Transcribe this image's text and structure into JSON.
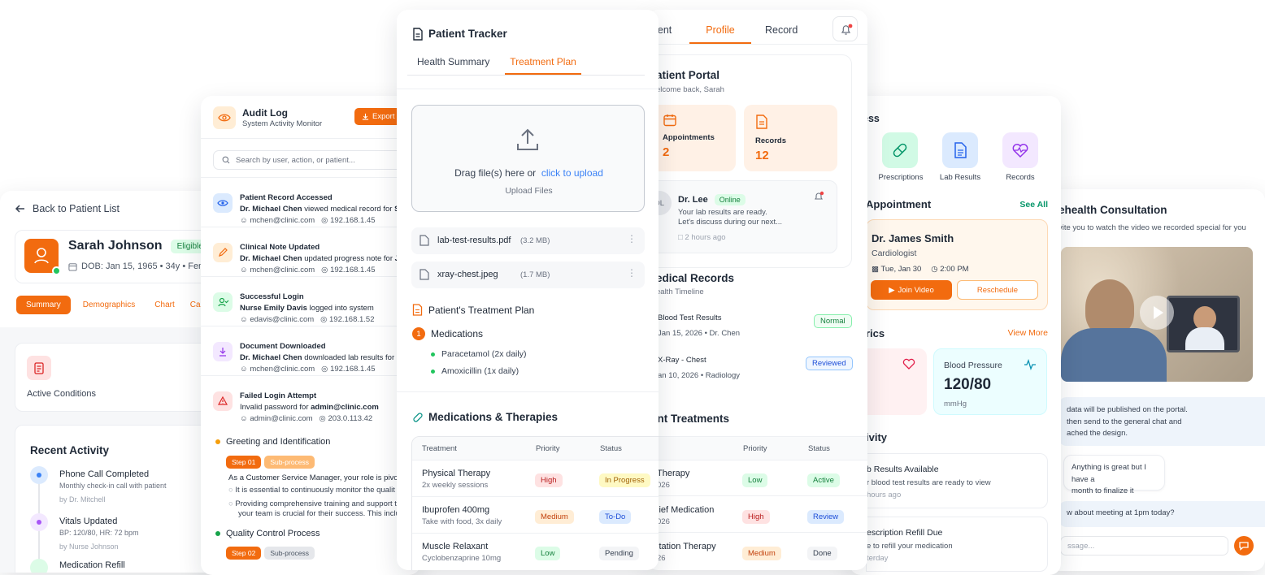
{
  "colors": {
    "accent": "#f26b0f",
    "green": "#16a34a",
    "blue": "#2563eb"
  },
  "patientList": {
    "back": "Back to Patient List",
    "name": "Sarah Johnson",
    "eligible": "Eligible",
    "dob": "DOB: Jan 15, 1965 • 34y • Fema",
    "tabs": [
      "Summary",
      "Demographics",
      "Chart",
      "Ca"
    ],
    "activeConditions": "Active Conditions",
    "recentActivity": "Recent Activity",
    "activities": [
      {
        "title": "Phone Call Completed",
        "desc": "Monthly check-in call with patient",
        "by": "by Dr. Mitchell"
      },
      {
        "title": "Vitals Updated",
        "desc": "BP: 120/80, HR: 72 bpm",
        "by": "by Nurse Johnson"
      },
      {
        "title": "Medication Refill",
        "desc": "",
        "by": ""
      }
    ]
  },
  "audit": {
    "title": "Audit Log",
    "subtitle": "System Activity Monitor",
    "export": "Export",
    "search_placeholder": "Search by user, action, or patient...",
    "entries": [
      {
        "title": "Patient Record Accessed",
        "actor": "Dr. Michael Chen",
        "action": " viewed medical record for ",
        "target": "Sa",
        "email": "mchen@clinic.com",
        "ip": "192.168.1.45"
      },
      {
        "title": "Clinical Note Updated",
        "actor": "Dr. Michael Chen",
        "action": " updated progress note for ",
        "target": "Ja",
        "email": "mchen@clinic.com",
        "ip": "192.168.1.45"
      },
      {
        "title": "Successful Login",
        "actor": "Nurse Emily Davis",
        "action": " logged into system",
        "target": "",
        "email": "edavis@clinic.com",
        "ip": "192.168.1.52"
      },
      {
        "title": "Document Downloaded",
        "actor": "Dr. Michael Chen",
        "action": " downloaded lab results for ",
        "target": "S",
        "email": "mchen@clinic.com",
        "ip": "192.168.1.45"
      },
      {
        "title": "Failed Login Attempt",
        "actor": "",
        "action": "Invalid password for ",
        "target": "admin@clinic.com",
        "email": "admin@clinic.com",
        "ip": "203.0.113.42"
      }
    ],
    "workflow": [
      {
        "title": "Greeting and Identification",
        "step": "Step 01",
        "sub": "Sub-process",
        "text": "As a Customer Service Manager, your role is pivot",
        "bullets": [
          "It is essential to continuously monitor the qualit",
          "Providing comprehensive training and support t",
          "your team is crucial for their success. This inclu"
        ]
      },
      {
        "title": "Quality Control Process",
        "step": "Step 02",
        "sub": "Sub-process"
      }
    ]
  },
  "tracker": {
    "title": "Patient Tracker",
    "tabs": [
      "Health Summary",
      "Treatment Plan"
    ],
    "upload_text": "Drag file(s) here or",
    "upload_link": "click to upload",
    "upload_sub": "Upload Files",
    "files": [
      {
        "name": "lab-test-results.pdf",
        "size": "(3.2 MB)"
      },
      {
        "name": "xray-chest.jpeg",
        "size": "(1.7 MB)"
      }
    ],
    "plan_title": "Patient's Treatment Plan",
    "plan_num": "1",
    "plan_section": "Medications",
    "meds": [
      "Paracetamol (2x daily)",
      "Amoxicillin (1x daily)"
    ],
    "mt_title": "Medications & Therapies",
    "headers": [
      "Treatment",
      "Priority",
      "Status"
    ],
    "rows": [
      {
        "name": "Physical Therapy",
        "sub": "2x weekly sessions",
        "priority": "High",
        "status": "In Progress"
      },
      {
        "name": "Ibuprofen 400mg",
        "sub": "Take with food, 3x daily",
        "priority": "Medium",
        "status": "To-Do"
      },
      {
        "name": "Muscle Relaxant",
        "sub": "Cyclobenzaprine 10mg",
        "priority": "Low",
        "status": "Pending"
      }
    ]
  },
  "portal": {
    "tabs": [
      "tment",
      "Profile",
      "Record"
    ],
    "title": "atient Portal",
    "welcome": "elcome back, Sarah",
    "stat1_label": "Appointments",
    "stat1_value": "2",
    "stat2_label": "Records",
    "stat2_value": "12",
    "msg_name": "Dr. Lee",
    "msg_status": "Online",
    "msg_avatar": "DL",
    "msg_text1": "Your lab results are ready.",
    "msg_text2": "Let's discuss during our next...",
    "msg_time": "2 hours ago",
    "rec_title": "edical Records",
    "rec_sub": "ealth Timeline",
    "records": [
      {
        "title": "Blood Test Results",
        "meta": "Jan 15, 2026 • Dr. Chen",
        "badge": "Normal"
      },
      {
        "title": "X-Ray - Chest",
        "meta": "an 10, 2026 • Radiology",
        "badge": "Reviewed"
      }
    ],
    "tr_title": "ent Treatments",
    "tr_headers": [
      "Priority",
      "Status"
    ],
    "tr_rows": [
      {
        "name": "Therapy",
        "sub": "026",
        "priority": "Low",
        "status": "Active"
      },
      {
        "name": "lief Medication",
        "sub": "026",
        "priority": "High",
        "status": "Review"
      },
      {
        "name": "itation Therapy",
        "sub": "26",
        "priority": "Medium",
        "status": "Done"
      }
    ]
  },
  "access": {
    "title": "ess",
    "items": [
      "Prescriptions",
      "Lab Results",
      "Records"
    ],
    "appt_title": "Appointment",
    "see_all": "See All",
    "doctor": "Dr. James Smith",
    "spec": "Cardiologist",
    "date": "Tue, Jan 30",
    "time": "2:00 PM",
    "join": "Join Video",
    "reschedule": "Reschedule",
    "metrics_title": "rics",
    "view_more": "View More",
    "bp_label": "Blood Pressure",
    "bp_value": "120/80",
    "bp_unit": "mmHg",
    "activity_title": "ivity",
    "act1_title": "b Results Available",
    "act1_desc": "r blood test results are ready to view",
    "act1_time": "hours ago",
    "act2_title": "escription Refill Due",
    "act2_desc": "e to refill your medication",
    "act2_time": "terday"
  },
  "consult": {
    "title": "ehealth Consultation",
    "sub": "vite you to watch the video we recorded special for you",
    "msg1": [
      "data will be published on the portal.",
      "then send to the general chat and",
      "ached the design."
    ],
    "msg2": [
      "Anything is great but I have a",
      "month to finalize it"
    ],
    "msg3": "w about meeting at 1pm today?",
    "input_placeholder": "ssage..."
  }
}
